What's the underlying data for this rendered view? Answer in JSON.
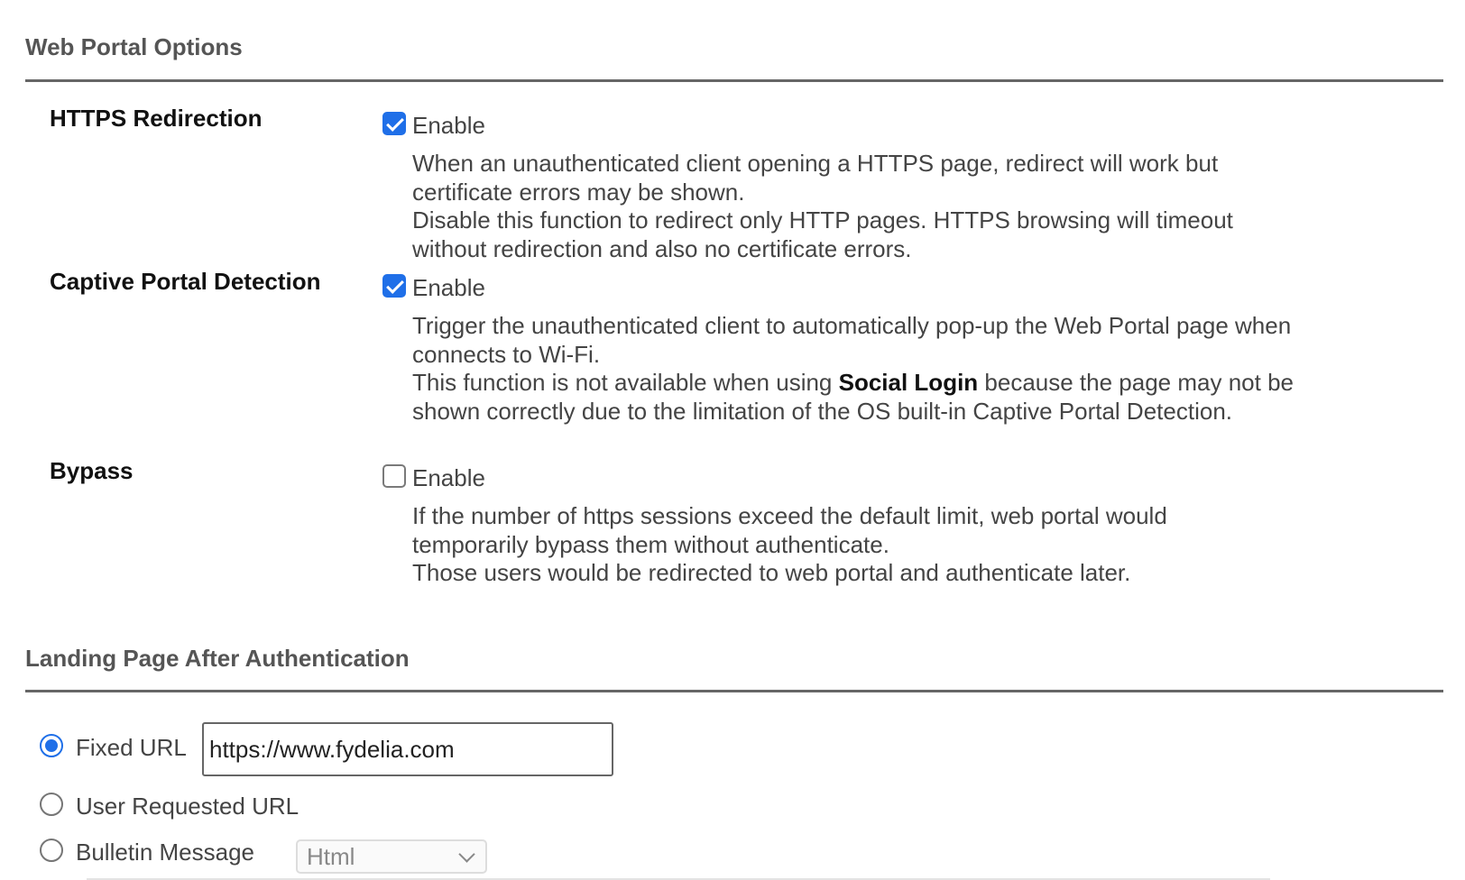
{
  "web_portal_options": {
    "title": "Web Portal Options",
    "options": [
      {
        "label": "HTTPS Redirection",
        "enable_label": "Enable",
        "checked": true,
        "desc_lines": [
          "When an unauthenticated client opening a HTTPS page, redirect will work but certificate errors may be shown.",
          "Disable this function to redirect only HTTP pages. HTTPS browsing will timeout without redirection and also no certificate errors."
        ]
      },
      {
        "label": "Captive Portal Detection",
        "enable_label": "Enable",
        "checked": true,
        "desc_lines": [
          "Trigger the unauthenticated client to automatically pop-up the Web Portal page when connects to Wi-Fi."
        ],
        "desc_line2_before": "This function is not available when using ",
        "desc_line2_bold": "Social Login",
        "desc_line2_after": " because the page may not be shown correctly due to the limitation of the OS built-in Captive Portal Detection."
      },
      {
        "label": "Bypass",
        "enable_label": "Enable",
        "checked": false,
        "desc_lines": [
          "If the number of https sessions exceed the default limit, web portal would temporarily bypass them without authenticate.",
          "Those users would be redirected to web portal and authenticate later."
        ]
      }
    ]
  },
  "landing_page": {
    "title": "Landing Page After Authentication",
    "selected": "Fixed URL",
    "fixed_url_label": "Fixed URL",
    "fixed_url_value": "https://www.fydelia.com",
    "user_requested_label": "User Requested URL",
    "bulletin_label": "Bulletin Message",
    "bulletin_format": "Html"
  },
  "colors": {
    "accent": "#1f6fe8",
    "rule": "#666666"
  }
}
